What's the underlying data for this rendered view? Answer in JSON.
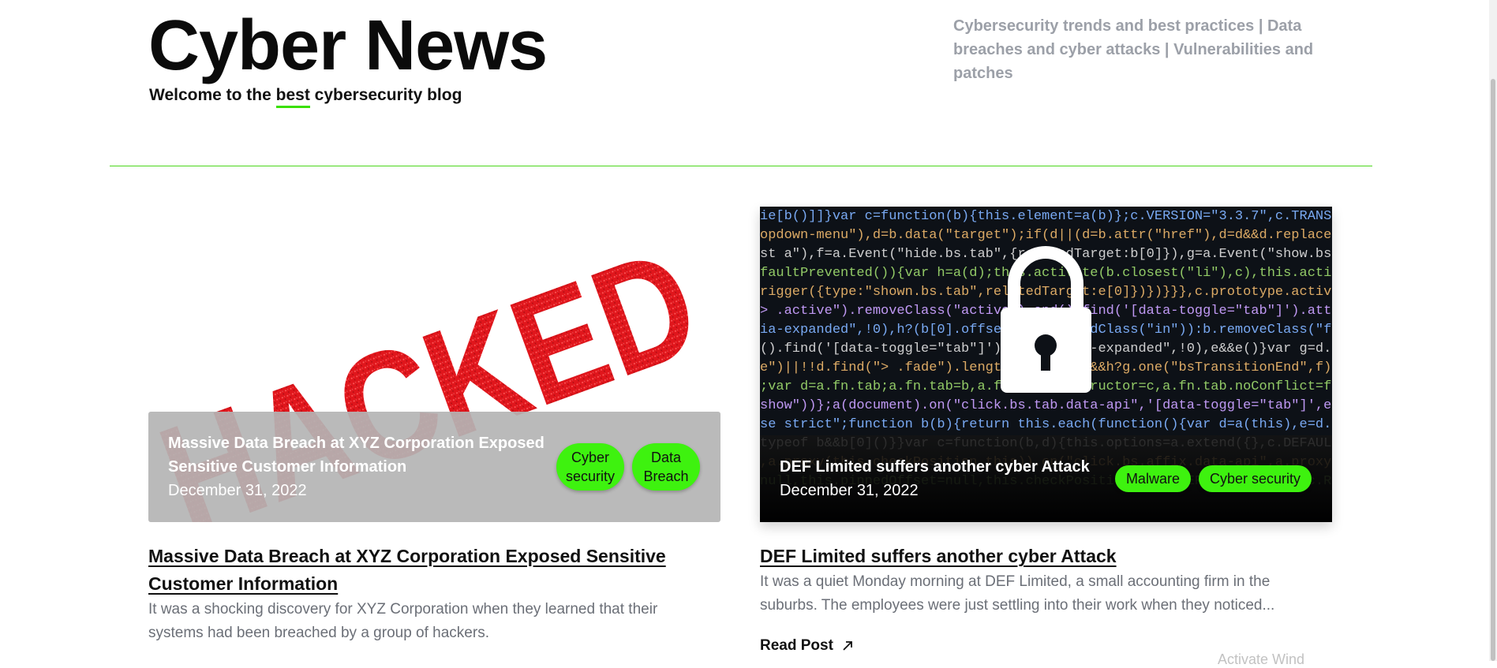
{
  "header": {
    "site_title": "Cyber News",
    "tagline_before": "Welcome to the ",
    "tagline_highlight": "best",
    "tagline_after": " cybersecurity blog",
    "topics": "Cybersecurity trends and best practices | Data breaches and cyber attacks | Vulnerabilities and patches"
  },
  "posts": [
    {
      "image_text": "HACKED",
      "overlay_title": "Massive Data Breach at XYZ Corporation Exposed Sensitive Customer Information",
      "date": "December 31, 2022",
      "tags": [
        "Cyber security",
        "Data Breach"
      ],
      "title": "Massive Data Breach at XYZ Corporation Exposed Sensitive Customer Information",
      "excerpt": "It was a shocking discovery for XYZ Corporation when they learned that their systems had been breached by a group of hackers."
    },
    {
      "overlay_title": "DEF Limited suffers another cyber Attack",
      "date": "December 31, 2022",
      "tags": [
        "Malware",
        "Cyber security"
      ],
      "title": "DEF Limited suffers another cyber Attack",
      "excerpt": "It was a quiet Monday morning at DEF Limited, a small accounting firm in the suburbs. The employees were just settling into their work when they noticed...",
      "read_label": "Read Post"
    }
  ],
  "system": {
    "activate_hint": "Activate Wind"
  },
  "colors": {
    "accent_green": "#3ef20f",
    "divider_green": "#4cd61c",
    "hacked_red": "#e0161c"
  }
}
